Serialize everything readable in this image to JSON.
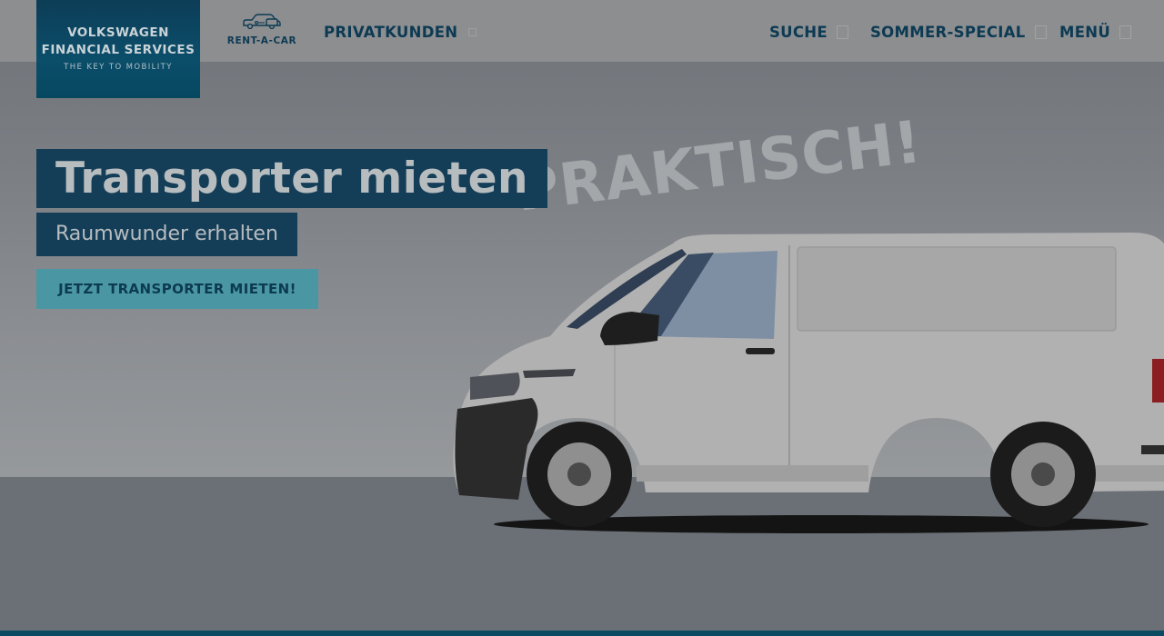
{
  "brand": {
    "line1": "VOLKSWAGEN",
    "line2": "FINANCIAL SERVICES",
    "tagline": "THE KEY TO MOBILITY"
  },
  "rent_a_car": {
    "label": "RENT-A-CAR",
    "icon": "car-key-icon"
  },
  "nav": {
    "privatkunden": "PRIVATKUNDEN",
    "suche": "SUCHE",
    "sommer_special": "SOMMER-SPECIAL",
    "menu": "MENÜ"
  },
  "hero": {
    "title": "Transporter mieten",
    "subtitle": "Raumwunder erhalten",
    "cta": "JETZT TRANSPORTER MIETEN!",
    "overlay_text": "PRAKTISCH!",
    "image": "van-image"
  },
  "colors": {
    "brand_dark": "#143e58",
    "nav_text": "#0d3a53",
    "cta_bg": "#4a97a3",
    "header_bg": "#8c8e90",
    "page_overlay": "#6b7076"
  }
}
